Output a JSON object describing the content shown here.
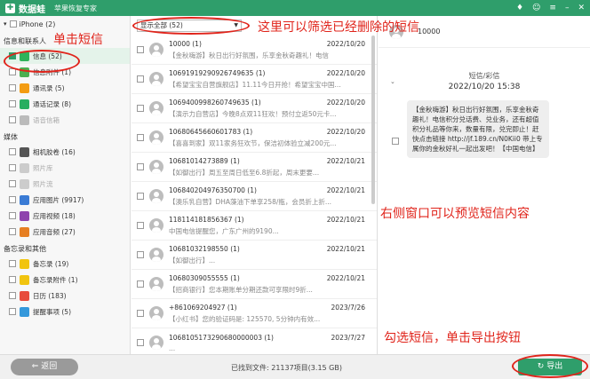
{
  "app": {
    "name": "数据蛙",
    "subtitle": "苹果恢复专家"
  },
  "device": {
    "label": "iPhone (2)"
  },
  "sidebar": {
    "sections": [
      {
        "title": "信息和联系人",
        "items": [
          {
            "label": "信息 (52)",
            "color": "#2fb35a",
            "checked": true,
            "selected": true
          },
          {
            "label": "信息附件 (1)",
            "color": "#4caf50"
          },
          {
            "label": "通讯录 (5)",
            "color": "#f39c12"
          },
          {
            "label": "通话记录 (8)",
            "color": "#27ae60"
          },
          {
            "label": "语音信箱",
            "color": "#bbbbbb",
            "dim": true
          }
        ]
      },
      {
        "title": "媒体",
        "items": [
          {
            "label": "相机胶卷 (16)",
            "color": "#555555"
          },
          {
            "label": "照片库",
            "color": "#cccccc",
            "dim": true
          },
          {
            "label": "照片流",
            "color": "#cccccc",
            "dim": true
          },
          {
            "label": "应用图片 (9917)",
            "color": "#3a7bd5"
          },
          {
            "label": "应用视频 (18)",
            "color": "#8e44ad"
          },
          {
            "label": "应用音频 (27)",
            "color": "#e67e22"
          }
        ]
      },
      {
        "title": "备忘录和其他",
        "items": [
          {
            "label": "备忘录 (19)",
            "color": "#f1c40f"
          },
          {
            "label": "备忘录附件 (1)",
            "color": "#f1c40f"
          },
          {
            "label": "日历 (183)",
            "color": "#e74c3c"
          },
          {
            "label": "提醒事项 (5)",
            "color": "#3498db"
          }
        ]
      }
    ]
  },
  "list": {
    "filter": "显示全部 (52)",
    "rows": [
      {
        "name": "10000 (1)",
        "date": "2022/10/20",
        "preview": "【金秋嗨游】秋日出行好氛围，乐享金秋奇趣礼！电信"
      },
      {
        "name": "10691919290926749635 (1)",
        "date": "2022/10/20",
        "preview": "【希望宝宝自营旗舰店】11.11今日开抢！希望宝宝中国..."
      },
      {
        "name": "1069400998260749635 (1)",
        "date": "2022/10/20",
        "preview": "【演示力自营店】今晚8点双11狂欢！预付立返50元卡..."
      },
      {
        "name": "10680645660601783 (1)",
        "date": "2022/10/20",
        "preview": "【喜喜到家】双11家务狂欢节，保洁初体验立减200元..."
      },
      {
        "name": "10681014273889 (1)",
        "date": "2022/10/21",
        "preview": "【如御出行】周五至周日低至6.8折起，周末更要..."
      },
      {
        "name": "106840204976350700 (1)",
        "date": "2022/10/21",
        "preview": "【澳乐乳自营】DHA藻油下单享258/瓶，会员折上折..."
      },
      {
        "name": "118114181856367 (1)",
        "date": "2022/10/21",
        "preview": "中国电信提醒您，广东广州的9190..."
      },
      {
        "name": "10681032198550 (1)",
        "date": "2022/10/21",
        "preview": "【如御出行】..."
      },
      {
        "name": "10680309055555 (1)",
        "date": "2022/10/21",
        "preview": "【招商银行】您本期账单分期还款可享限时9折..."
      },
      {
        "name": "+861069204927 (1)",
        "date": "2023/7/26",
        "preview": "【小红书】您的验证码是: 125570, 5分钟内有效..."
      },
      {
        "name": "1068105173290680000003 (1)",
        "date": "2023/7/27",
        "preview": "..."
      }
    ]
  },
  "preview": {
    "contact": "10000",
    "type": "短信/彩信",
    "date": "2022/10/20 15:38",
    "body": "【金秋嗨游】秋日出行好氛围，乐享金秋奇趣礼！电信积分兑话费、兑业务，还有超值积分礼品等你来，数量有限，兑完即止！赶快点击链接 http://jf.189.cn/N0Kii0 带上专属你的金秋好礼一起出发吧！【中国电信】"
  },
  "footer": {
    "back": "返回",
    "found": "已找到文件: 21137项目(3.15 GB)",
    "export": "导出"
  },
  "annotations": {
    "click_sms": "单击短信",
    "filter": "这里可以筛选已经删除的短信",
    "preview": "右侧窗口可以预览短信内容",
    "export": "勾选短信，单击导出按钮"
  }
}
